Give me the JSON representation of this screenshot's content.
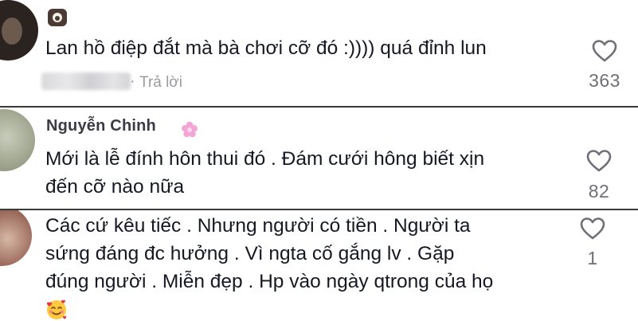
{
  "comments": [
    {
      "username": "",
      "text_lines": [
        "Lan hồ điệp đắt mà bà chơi cỡ đó :)))) quá đỉnh lun"
      ],
      "meta_separator": "·",
      "reply_label": "Trả lời",
      "likes": "363"
    },
    {
      "username": "Nguyễn Chinh",
      "text_lines": [
        "Mới là lễ đính hôn thui đó . Đám cưới hông biết xịn",
        "đến cỡ nào nữa"
      ],
      "likes": "82"
    },
    {
      "username": "",
      "text_lines": [
        "Các cứ kêu tiếc . Nhưng người có tiền . Người ta",
        "sứng đáng đc hưởng . Vì ngta cố gắng lv . Gặp",
        "đúng người . Miễn đẹp . Hp vào ngày qtrong của họ"
      ],
      "trailing_emoji": "smiling-face-with-hearts",
      "likes": "1"
    }
  ],
  "icons": {
    "like": "heart-outline-icon",
    "badge": "pink-flower-icon",
    "like_color": "#6f6f78",
    "flower_color": "#f3a6d6"
  }
}
